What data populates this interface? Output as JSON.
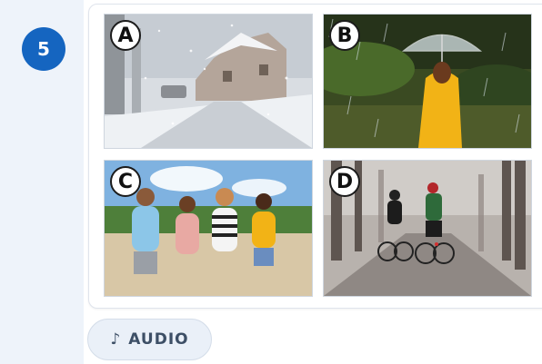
{
  "question": {
    "number": "5"
  },
  "options": [
    {
      "letter": "A",
      "scene": "snowy street"
    },
    {
      "letter": "B",
      "scene": "rain with umbrella"
    },
    {
      "letter": "C",
      "scene": "sunny day friends"
    },
    {
      "letter": "D",
      "scene": "foggy forest cyclists"
    }
  ],
  "audio_button": {
    "icon": "music-note-icon",
    "label": "AUDIO",
    "glyph": "♪"
  },
  "colors": {
    "accent": "#1565c0",
    "sidebar": "#eef3fa",
    "button_bg": "#eaf0f8"
  }
}
